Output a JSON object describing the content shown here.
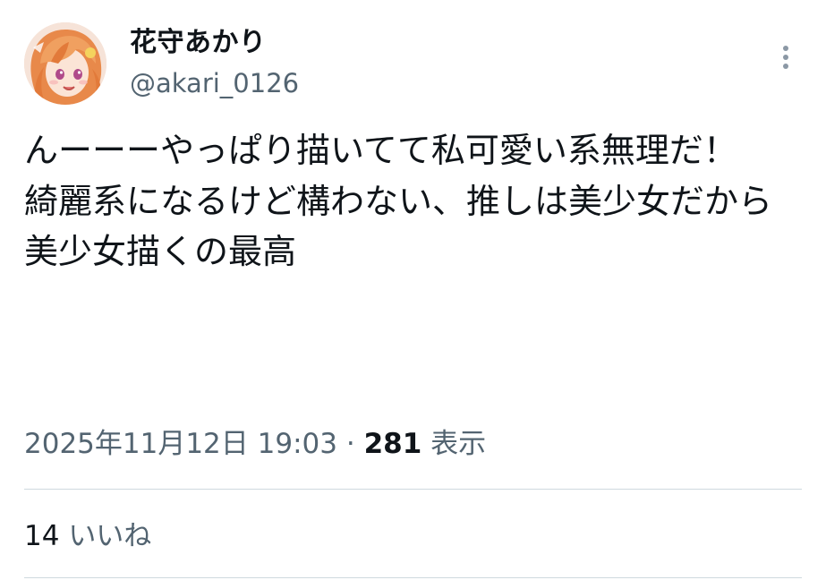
{
  "author": {
    "display_name": "花守あかり",
    "handle": "@akari_0126",
    "avatar_icon": "anime-avatar-icon"
  },
  "menu": {
    "icon": "more-vertical-icon"
  },
  "post": {
    "text": "んーーーやっぱり描いてて私可愛い系無理だ！\n綺麗系になるけど構わない、推しは美少女だから\n美少女描くの最高",
    "timestamp": "2025年11月12日 19:03",
    "separator": "·",
    "views_count": "281",
    "views_label": "表示"
  },
  "engagement": {
    "likes_count": "14",
    "likes_label": "いいね"
  },
  "colors": {
    "text_primary": "#0f1419",
    "text_secondary": "#536471",
    "divider": "#cfd9de",
    "avatar_hair": "#e8894a"
  }
}
